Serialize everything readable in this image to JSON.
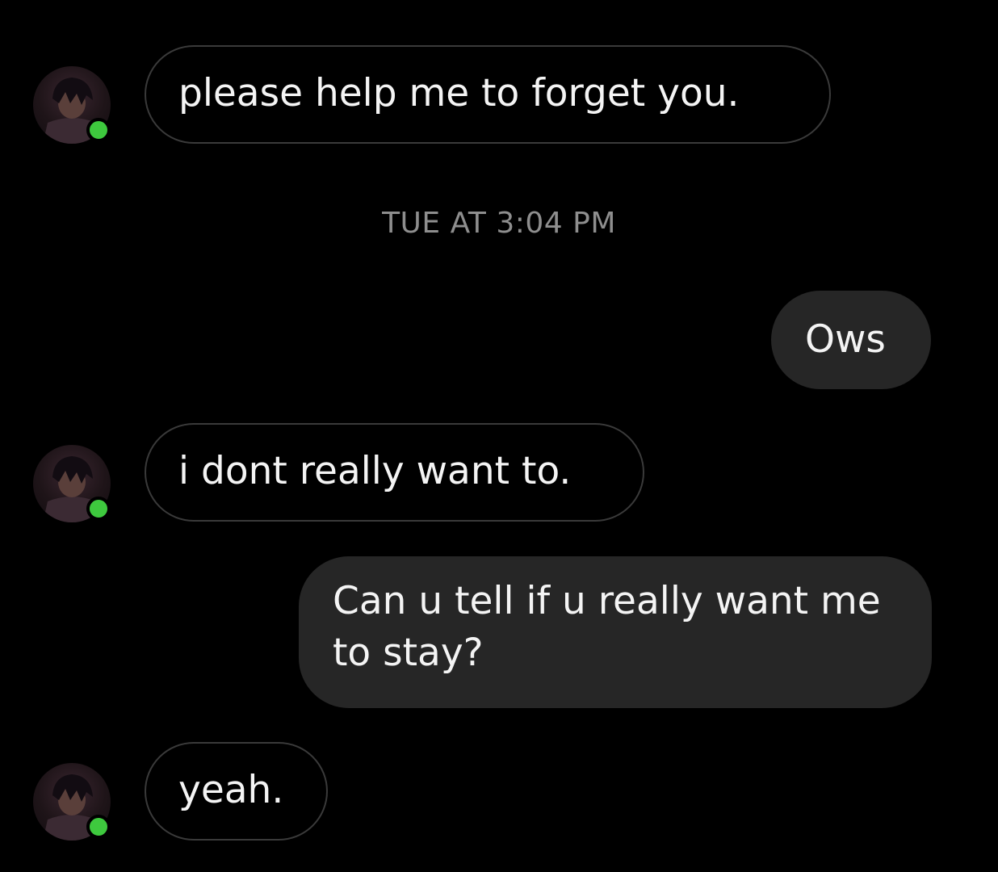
{
  "thread": {
    "timestamp": "TUE AT 3:04 PM",
    "messages": [
      {
        "direction": "incoming",
        "text": "please help me to forget you."
      },
      {
        "direction": "outgoing",
        "text": "Ows"
      },
      {
        "direction": "incoming",
        "text": "i dont really want to."
      },
      {
        "direction": "outgoing",
        "text": "Can u tell if u really want me to stay?"
      },
      {
        "direction": "incoming",
        "text": "yeah."
      }
    ]
  },
  "contact": {
    "avatar_icon": "profile-picture",
    "status": "online",
    "status_color": "#3ec93e"
  },
  "colors": {
    "background": "#000000",
    "incoming_border": "#3a3a3a",
    "outgoing_fill": "#262626",
    "timestamp_text": "#8e8e8e"
  }
}
